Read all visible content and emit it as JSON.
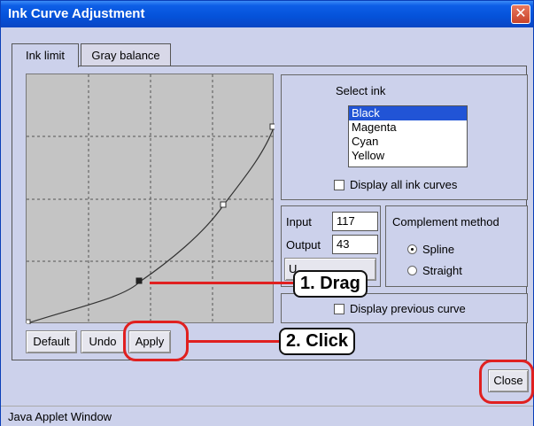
{
  "window": {
    "title": "Ink Curve Adjustment",
    "close_glyph": "✕"
  },
  "tabs": [
    {
      "label": "Ink limit",
      "active": true
    },
    {
      "label": "Gray balance",
      "active": false
    }
  ],
  "select_ink": {
    "heading": "Select ink",
    "options": [
      "Black",
      "Magenta",
      "Cyan",
      "Yellow"
    ],
    "selected": "Black",
    "display_all_label": "Display all ink curves",
    "display_all_checked": false
  },
  "io": {
    "input_label": "Input",
    "input_value": "117",
    "output_label": "Output",
    "output_value": "43",
    "hidden_button_fragment": "U"
  },
  "complement": {
    "heading": "Complement method",
    "options": [
      {
        "label": "Spline",
        "selected": true
      },
      {
        "label": "Straight",
        "selected": false
      }
    ]
  },
  "display_previous": {
    "label": "Display previous curve",
    "checked": false
  },
  "buttons": {
    "default": "Default",
    "undo": "Undo",
    "apply": "Apply",
    "close": "Close"
  },
  "callouts": {
    "drag": "1. Drag",
    "click": "2. Click"
  },
  "status": "Java Applet Window",
  "colors": {
    "title_blue": "#0552d9",
    "selection": "#2154d6",
    "highlight_red": "#e02020",
    "window_bg": "#ccd1eb"
  }
}
